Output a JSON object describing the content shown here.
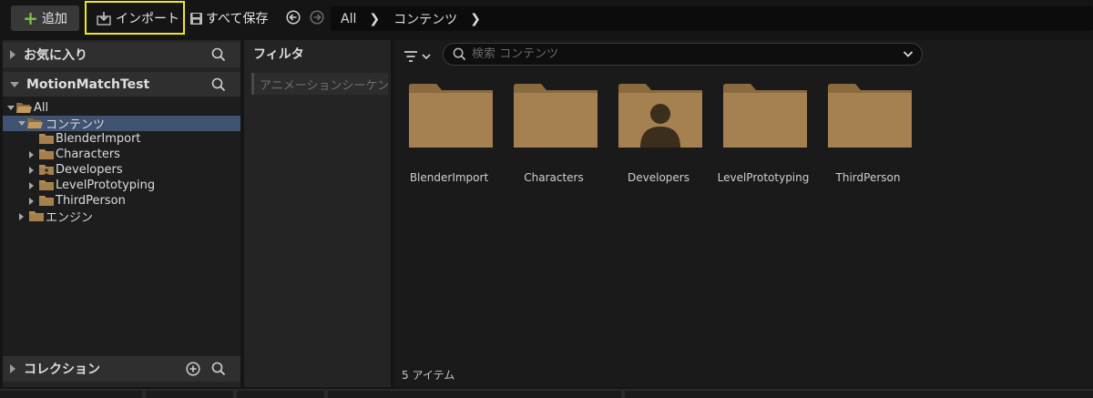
{
  "toolbar": {
    "add_label": "追加",
    "import_label": "インポート",
    "save_all_label": "すべて保存"
  },
  "path": {
    "root": "All",
    "current": "コンテンツ"
  },
  "sidebar": {
    "favorites_title": "お気に入り",
    "project_title": "MotionMatchTest",
    "collections_title": "コレクション",
    "tree": [
      {
        "label": "All"
      },
      {
        "label": "コンテンツ"
      },
      {
        "label": "BlenderImport"
      },
      {
        "label": "Characters"
      },
      {
        "label": "Developers"
      },
      {
        "label": "LevelPrototyping"
      },
      {
        "label": "ThirdPerson"
      },
      {
        "label": "エンジン"
      }
    ]
  },
  "filters": {
    "title": "フィルタ",
    "items": [
      "アニメーションシーケンス"
    ]
  },
  "search": {
    "placeholder": "検索 コンテンツ"
  },
  "content": {
    "folders": [
      {
        "label": "BlenderImport",
        "icon": "folder-icon"
      },
      {
        "label": "Characters",
        "icon": "folder-icon"
      },
      {
        "label": "Developers",
        "icon": "developer-folder-icon"
      },
      {
        "label": "LevelPrototyping",
        "icon": "folder-icon"
      },
      {
        "label": "ThirdPerson",
        "icon": "folder-icon"
      }
    ],
    "item_count": "5 アイテム"
  },
  "colors": {
    "accent_highlight": "#f0ea1a",
    "add_plus": "#7cc043",
    "selection": "#3f5270",
    "folder": "#9c7a48"
  }
}
